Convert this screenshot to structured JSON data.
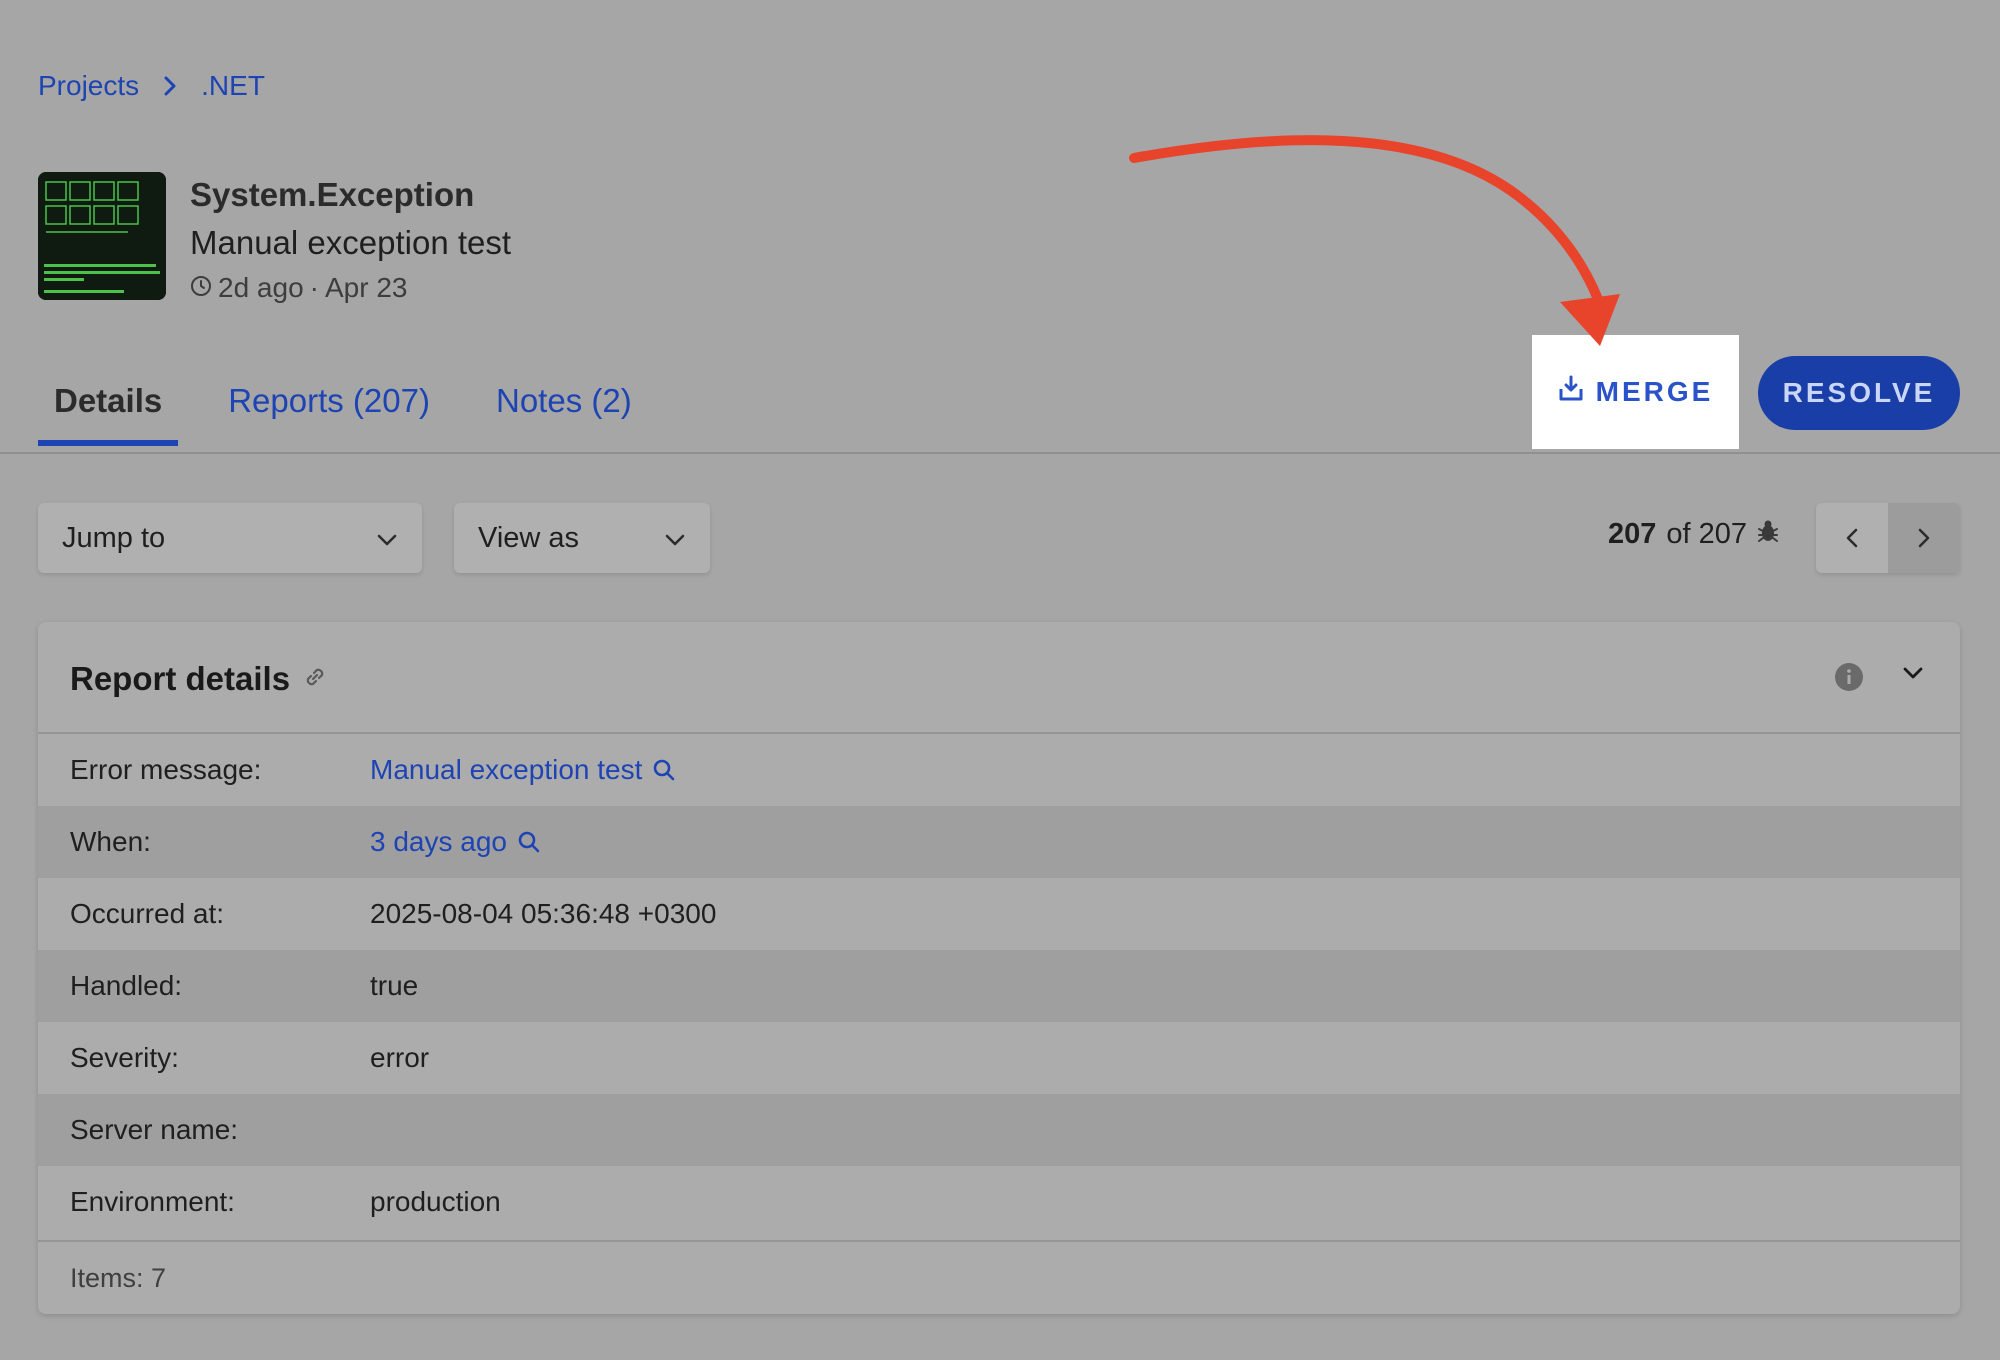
{
  "breadcrumb": {
    "items": [
      "Projects",
      ".NET"
    ]
  },
  "header": {
    "title": "System.Exception",
    "subtitle": "Manual exception test",
    "time_ago": "2d ago",
    "separator": "·",
    "date": "Apr 23"
  },
  "tabs": [
    {
      "label": "Details"
    },
    {
      "label": "Reports (207)"
    },
    {
      "label": "Notes (2)"
    }
  ],
  "actions": {
    "merge_label": "MERGE",
    "resolve_label": "RESOLVE"
  },
  "toolbar": {
    "jump_to": "Jump to",
    "view_as": "View as",
    "counter_current": "207",
    "counter_of": "of 207"
  },
  "report": {
    "title": "Report details",
    "rows": [
      {
        "label": "Error message:",
        "value": "Manual exception test"
      },
      {
        "label": "When:",
        "value": "3 days ago"
      },
      {
        "label": "Occurred at:",
        "value": "2025-08-04 05:36:48 +0300"
      },
      {
        "label": "Handled:",
        "value": "true"
      },
      {
        "label": "Severity:",
        "value": "error"
      },
      {
        "label": "Server name:",
        "value": ""
      },
      {
        "label": "Environment:",
        "value": "production"
      }
    ],
    "footer": "Items: 7"
  },
  "colors": {
    "accent": "#1e44b4",
    "annotation_arrow": "#e8442c",
    "overlay_bg": "#a6a6a6"
  }
}
